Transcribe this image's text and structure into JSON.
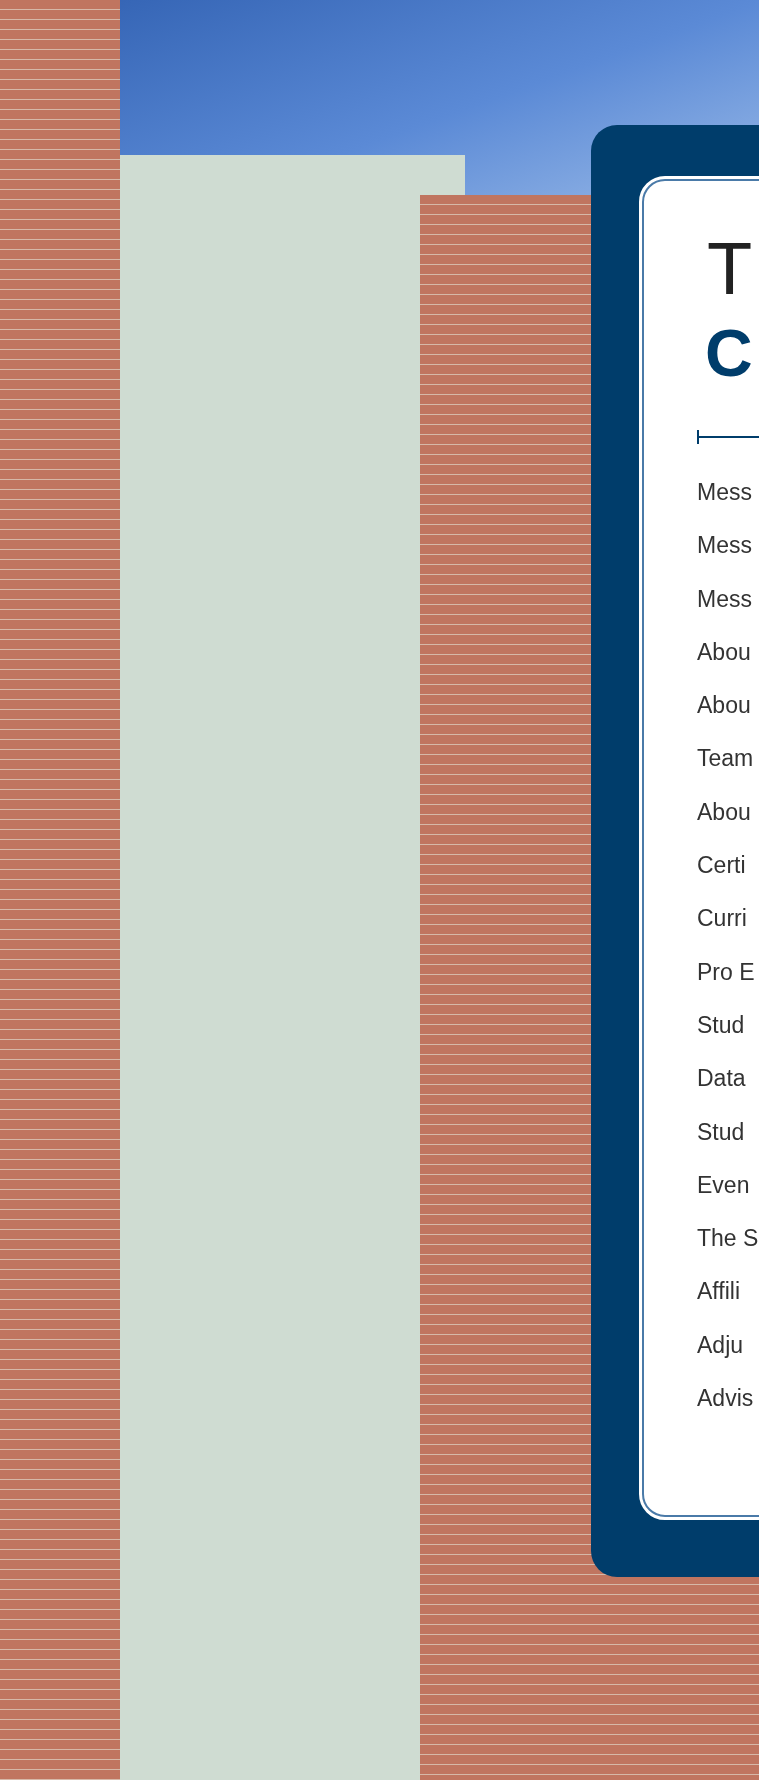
{
  "title": {
    "line_1": "T",
    "line_2": "C"
  },
  "items": [
    "Mess",
    "Mess",
    "Mess",
    "Abou",
    "Abou",
    "Team",
    "Abou",
    "Certi",
    "Curri",
    "Pro E",
    "Stud",
    "Data",
    "Stud",
    "Even",
    "The S",
    "Affili",
    "Adju",
    "Advis"
  ]
}
